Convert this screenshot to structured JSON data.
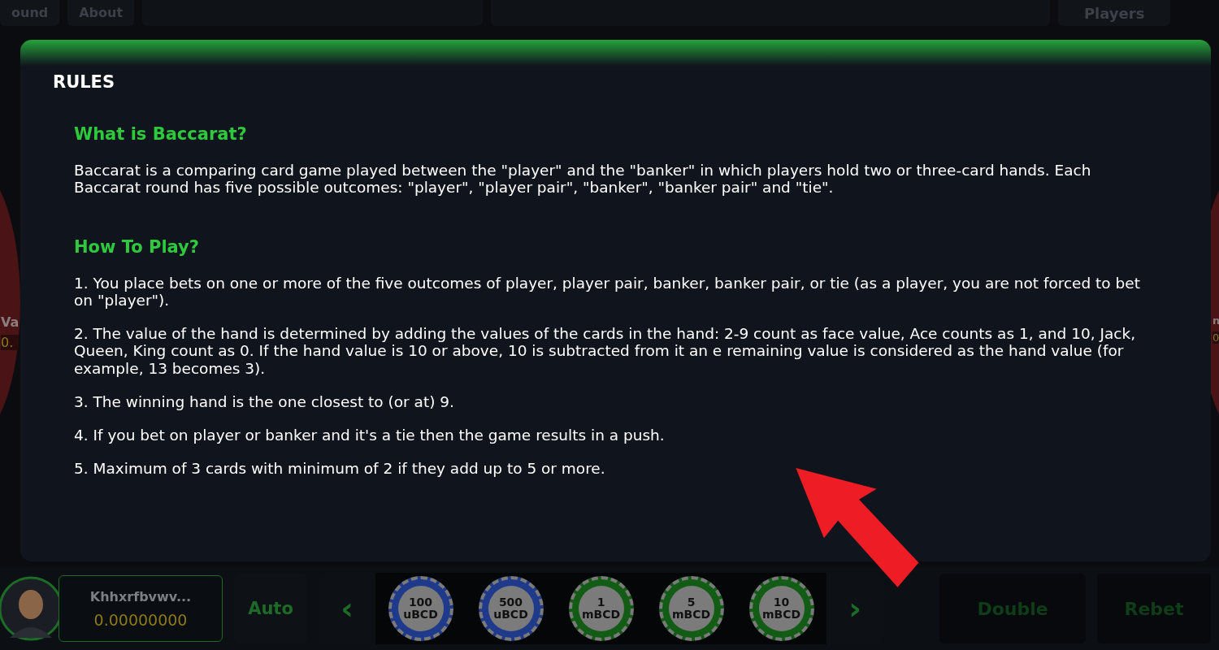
{
  "top_bar": {
    "tabs": [
      {
        "label": "ound"
      },
      {
        "label": "About"
      }
    ],
    "players_button": "Players"
  },
  "side_players": [
    {
      "name": "Va",
      "balance": "0."
    },
    {
      "name": "n",
      "balance": "0"
    }
  ],
  "rules_modal": {
    "title": "RULES",
    "sections": [
      {
        "heading": "What is Baccarat?",
        "paragraphs": [
          "Baccarat is a comparing card game played between the \"player\" and the \"banker\" in which players hold two or three-card hands. Each Baccarat round has five possible outcomes: \"player\", \"player pair\", \"banker\", \"banker pair\" and \"tie\"."
        ]
      },
      {
        "heading": "How To Play?",
        "paragraphs": [
          "1. You place bets on one or more of the five outcomes of player, player pair, banker, banker pair, or tie (as a player, you are not forced to bet on \"player\").",
          "2. The value of the hand is determined by adding the values of the cards in the hand: 2-9 count as face value, Ace counts as 1, and 10, Jack, Queen, King count as 0. If the hand value is 10 or above, 10 is subtracted from it an e remaining value is considered as the hand value (for example, 13 becomes 3).",
          "3. The winning hand is the one closest to (or at) 9.",
          "4. If you bet on player or banker and it's a tie then the game results in a push.",
          "5. Maximum of 3 cards with minimum of 2 if they add up to 5 or more."
        ]
      }
    ]
  },
  "bottom_bar": {
    "player": {
      "name": "Khhxrfbvwv...",
      "balance": "0.00000000"
    },
    "auto_button": "Auto",
    "prev_arrow": "‹",
    "next_arrow": "›",
    "chips": [
      {
        "amount": "100",
        "unit": "uBCD",
        "color": "#1f3a8a"
      },
      {
        "amount": "500",
        "unit": "uBCD",
        "color": "#1f3a8a"
      },
      {
        "amount": "1",
        "unit": "mBCD",
        "color": "#135c16"
      },
      {
        "amount": "5",
        "unit": "mBCD",
        "color": "#135c16"
      },
      {
        "amount": "10",
        "unit": "mBCD",
        "color": "#135c16"
      }
    ],
    "double_button": "Double",
    "rebet_button": "Rebet"
  }
}
